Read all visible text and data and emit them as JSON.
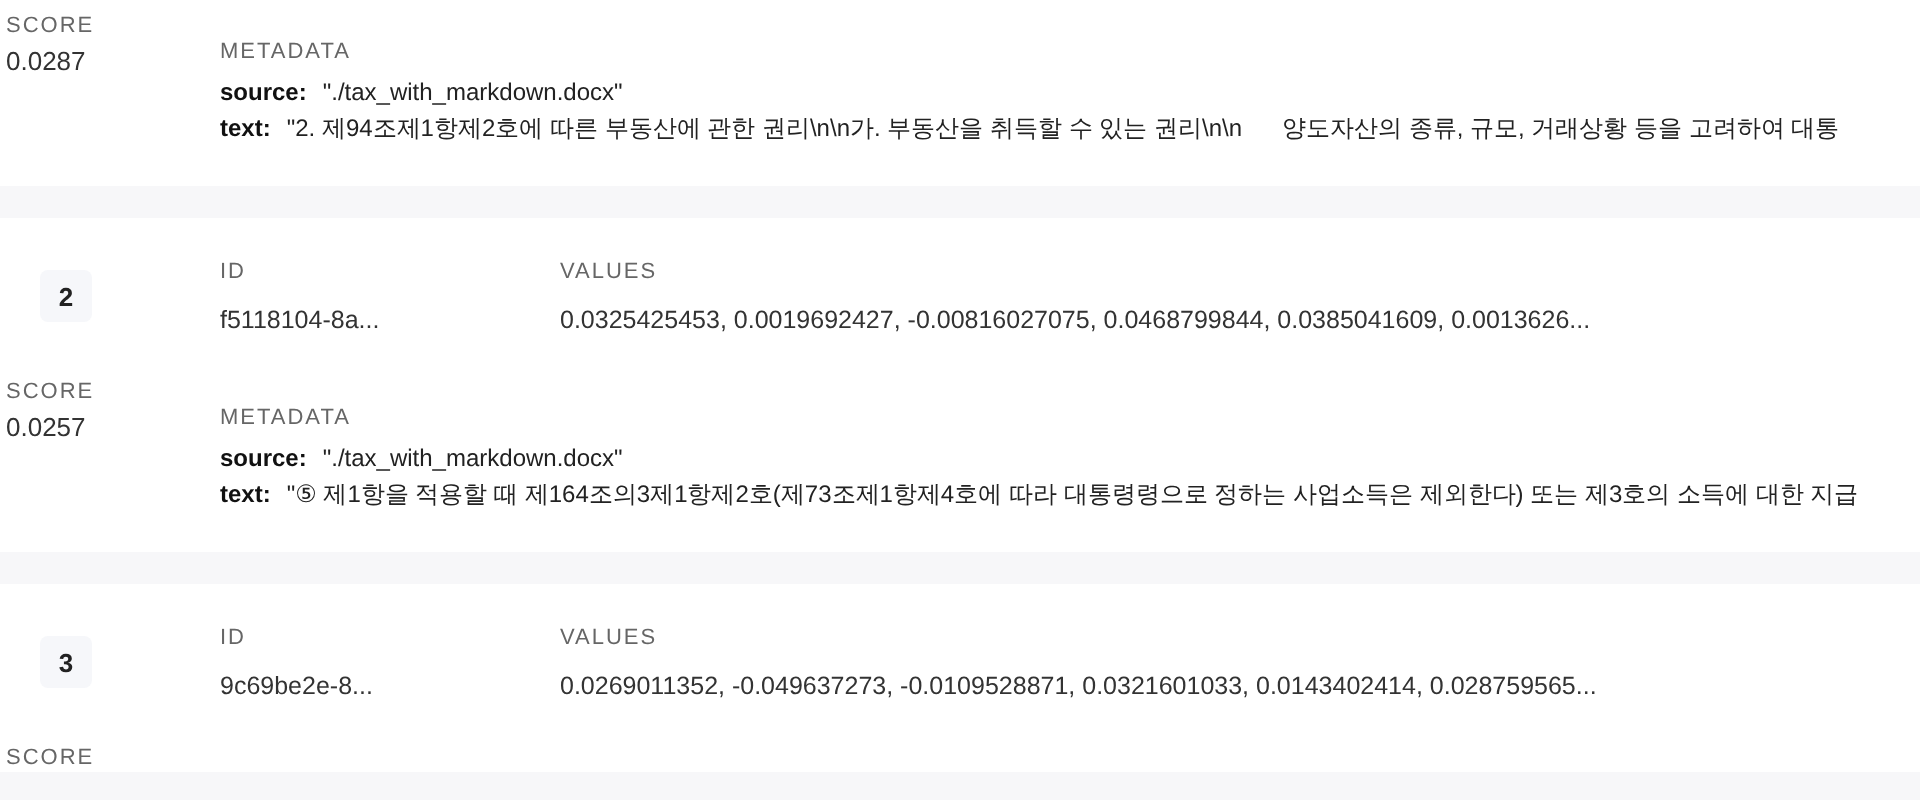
{
  "records": [
    {
      "score_label": "SCORE",
      "score": "0.0287",
      "metadata_label": "METADATA",
      "metadata": [
        {
          "key": "source:",
          "value": "\"./tax_with_markdown.docx\""
        },
        {
          "key": "text:",
          "value": "\"2. 제94조제1항제2호에 따른 부동산에 관한 권리\\n\\n가. 부동산을 취득할 수 있는 권리\\n\\n      양도자산의 종류, 규모, 거래상황 등을 고려하여 대통"
        }
      ]
    },
    {
      "index": "2",
      "id_label": "ID",
      "id": "f5118104-8a...",
      "values_label": "VALUES",
      "values": "0.0325425453, 0.0019692427, -0.00816027075, 0.0468799844, 0.0385041609, 0.0013626...",
      "score_label": "SCORE",
      "score": "0.0257",
      "metadata_label": "METADATA",
      "metadata": [
        {
          "key": "source:",
          "value": "\"./tax_with_markdown.docx\""
        },
        {
          "key": "text:",
          "value": "\"⑤ 제1항을 적용할 때 제164조의3제1항제2호(제73조제1항제4호에 따라 대통령령으로 정하는 사업소득은 제외한다) 또는 제3호의 소득에 대한 지급"
        }
      ]
    },
    {
      "index": "3",
      "id_label": "ID",
      "id": "9c69be2e-8...",
      "values_label": "VALUES",
      "values": "0.0269011352, -0.049637273, -0.0109528871, 0.0321601033, 0.0143402414, 0.028759565...",
      "score_label": "SCORE"
    }
  ]
}
